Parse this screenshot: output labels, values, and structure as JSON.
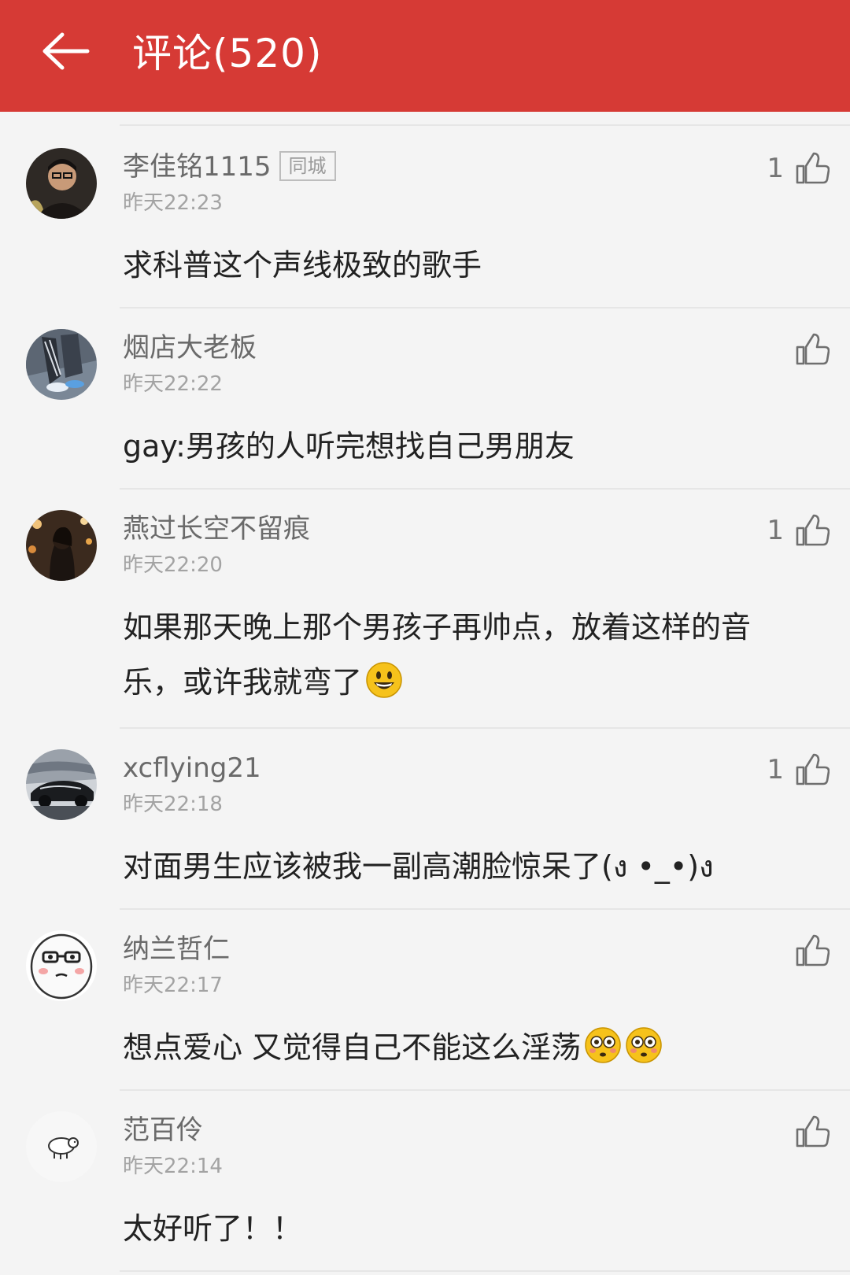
{
  "header": {
    "title": "评论(520)",
    "back_icon": "arrow-left-icon",
    "background": "#d63a35"
  },
  "comments": [
    {
      "username": "李佳铭1115",
      "tag": "同城",
      "time": "昨天22:23",
      "likes": "1",
      "text": "求科普这个声线极致的歌手"
    },
    {
      "username": "烟店大老板",
      "time": "昨天22:22",
      "likes": "",
      "text": "gay:男孩的人听完想找自己男朋友"
    },
    {
      "username": "燕过长空不留痕",
      "time": "昨天22:20",
      "likes": "1",
      "text_line1": "如果那天晚上那个男孩子再帅点，放着这样的音",
      "text_line2": "乐，或许我就弯了"
    },
    {
      "username": "xcflying21",
      "time": "昨天22:18",
      "likes": "1",
      "text": "对面男生应该被我一副高潮脸惊呆了(ง •_•)ง"
    },
    {
      "username": "纳兰哲仁",
      "time": "昨天22:17",
      "likes": "",
      "text": "想点爱心 又觉得自己不能这么淫荡"
    },
    {
      "username": "范百伶",
      "time": "昨天22:14",
      "likes": "",
      "text": "太好听了！！"
    }
  ]
}
